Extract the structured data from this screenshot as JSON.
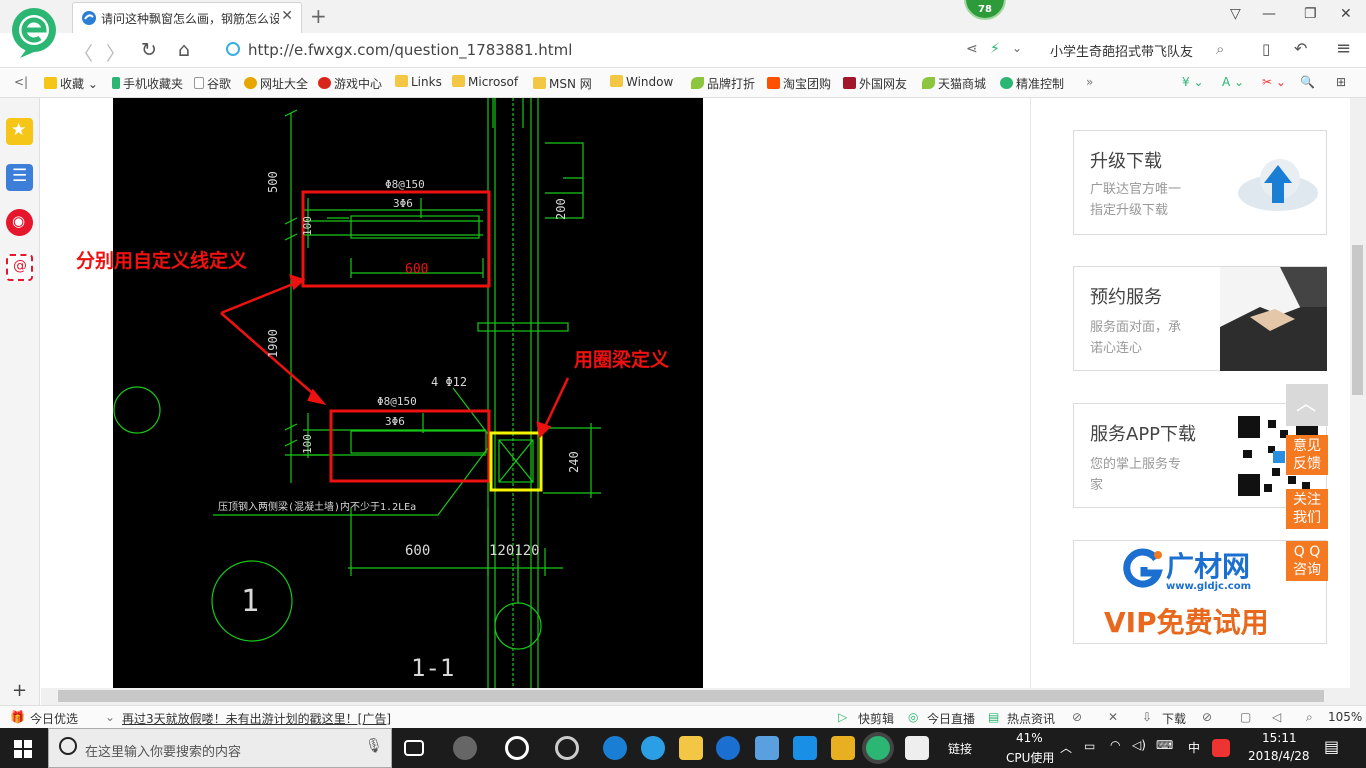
{
  "browser": {
    "tab_title": "请问这种飘窗怎么画，钢筋怎么设置",
    "badge": "78",
    "url": "http://e.fwxgx.com/question_1783881.html",
    "search_box": "小学生奇葩招式带飞队友"
  },
  "bookmarks": [
    "收藏",
    "手机收藏夹",
    "谷歌",
    "网址大全",
    "游戏中心",
    "Links",
    "Microsof",
    "MSN 网",
    "Window",
    "品牌打折",
    "淘宝团购",
    "外国网友",
    "天猫商城",
    "精准控制"
  ],
  "drawing": {
    "dim_500": "500",
    "dim_100a": "100",
    "dim_1900": "1900",
    "dim_100b": "100",
    "stirrup_top": "Φ8@150",
    "bars_top": "3Φ6",
    "dim_600_inner": "600",
    "dim_200": "200",
    "stirrup_bot": "Φ8@150",
    "bars_bot": "3Φ6",
    "col_bars": "4 Φ12",
    "dim_240": "240",
    "note": "压顶钢入两侧梁(混凝土墙)内不少于1.2LEa",
    "dim_600": "600",
    "dim_120_120": "120120",
    "axis_1": "1",
    "section": "1-1",
    "annot_left": "分别用自定义线定义",
    "annot_right": "用圈梁定义"
  },
  "side": {
    "c1_title": "升级下载",
    "c1_sub1": "广联达官方唯一",
    "c1_sub2": "指定升级下载",
    "c2_title": "预约服务",
    "c2_sub1": "服务面对面，承",
    "c2_sub2": "诺心连心",
    "c3_title": "服务APP下载",
    "c3_sub1": "您的掌上服务专",
    "c3_sub2": "家",
    "c4_brand": "广材网",
    "c4_url": "www.gldjc.com",
    "c4_vip": "VIP免费试用",
    "fb1": "意见",
    "fb2": "反馈",
    "fb3": "关注",
    "fb4": "我们",
    "fb5": "Q Q",
    "fb6": "咨询"
  },
  "status": {
    "today": "今日优选",
    "ad": "再过3天就放假喽！未有出游计划的戳这里！[广告]",
    "items": [
      "快剪辑",
      "今日直播",
      "热点资讯",
      "下载"
    ],
    "zoom": "105%"
  },
  "taskbar": {
    "search_placeholder": "在这里输入你要搜索的内容",
    "links": "链接",
    "cpu_pct": "41%",
    "cpu_label": "CPU使用",
    "ime": "中",
    "time": "15:11",
    "date": "2018/4/28"
  }
}
